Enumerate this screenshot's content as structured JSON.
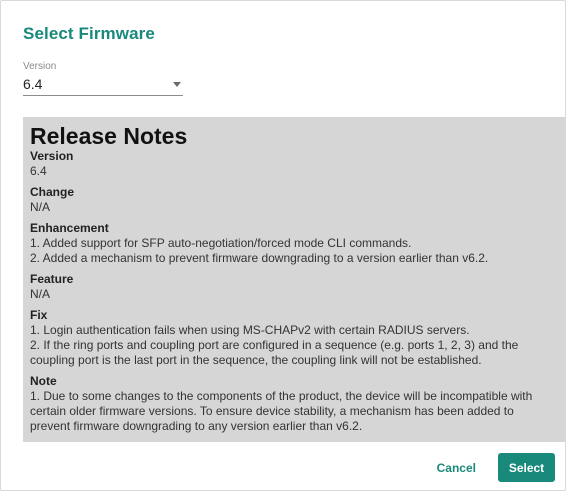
{
  "dialog": {
    "title": "Select Firmware"
  },
  "version_field": {
    "label": "Version",
    "value": "6.4"
  },
  "release_notes": {
    "title": "Release Notes",
    "sections": [
      {
        "heading": "Version",
        "lines": [
          "6.4"
        ]
      },
      {
        "heading": "Change",
        "lines": [
          "N/A"
        ]
      },
      {
        "heading": "Enhancement",
        "lines": [
          "1. Added support for SFP auto-negotiation/forced mode CLI commands.",
          "2. Added a mechanism to prevent firmware downgrading to a version earlier than v6.2."
        ]
      },
      {
        "heading": "Feature",
        "lines": [
          "N/A"
        ]
      },
      {
        "heading": "Fix",
        "lines": [
          "1. Login authentication fails when using MS-CHAPv2 with certain RADIUS servers.",
          "2. If the ring ports and coupling port are configured in a sequence (e.g. ports 1, 2, 3) and the",
          "coupling port is the last port in the sequence, the coupling link will not be established."
        ]
      },
      {
        "heading": "Note",
        "lines": [
          "1. Due to some changes to the components of the product, the device will be incompatible with",
          "certain older firmware versions. To ensure device stability, a mechanism has been added to",
          "prevent firmware downgrading to any version earlier than v6.2."
        ]
      }
    ]
  },
  "footer": {
    "cancel_label": "Cancel",
    "select_label": "Select"
  },
  "colors": {
    "accent": "#19897c",
    "notes_background": "#d6d6d6"
  }
}
